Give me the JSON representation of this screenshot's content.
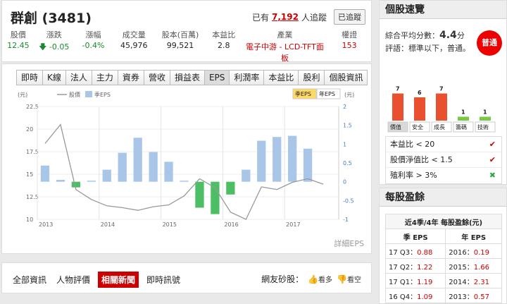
{
  "stock": {
    "name": "群創",
    "code": "(3481)"
  },
  "tracking": {
    "prefix": "已有",
    "count": "7,192",
    "suffix": "人追蹤",
    "button": "已追蹤"
  },
  "stats": [
    {
      "label": "股價",
      "value": "12.45",
      "tone": "green"
    },
    {
      "label": "漲跌",
      "value": "-0.05",
      "tone": "green",
      "arrow": "down"
    },
    {
      "label": "漲幅",
      "value": "-0.4%",
      "tone": "green"
    },
    {
      "label": "成交量",
      "value": "45,976",
      "tone": "plain"
    },
    {
      "label": "股本(百萬)",
      "value": "99,521",
      "tone": "plain"
    },
    {
      "label": "本益比",
      "value": "2.8",
      "tone": "plain"
    },
    {
      "label": "產業",
      "value": "電子中游 - LCD-TFT面板",
      "tone": "red"
    },
    {
      "label": "權證",
      "value": "153",
      "tone": "red"
    }
  ],
  "chart_tabs": [
    "即時",
    "K線",
    "法人",
    "主力",
    "資券",
    "營收",
    "損益表",
    "EPS",
    "利潤率",
    "本益比",
    "股利",
    "個股資訊"
  ],
  "active_chart_tab": "EPS",
  "detail_link": "詳細EPS",
  "chart_data": {
    "type": "bar+line",
    "legend": {
      "line": "股價",
      "bar": "季EPS"
    },
    "toggles": [
      "季EPS",
      "年EPS"
    ],
    "active_toggle": "季EPS",
    "y_left": {
      "unit": "(元)",
      "range": [
        10,
        22.5
      ],
      "ticks": [
        "22.5",
        "20",
        "17.5",
        "15",
        "12.5",
        "10"
      ]
    },
    "y_right": {
      "unit": "(元)",
      "range": [
        -1,
        2
      ],
      "ticks": [
        "2",
        "1.5",
        "1",
        "0.5",
        "0",
        "-0.5",
        "-1"
      ]
    },
    "x_ticks": [
      "2013",
      "2014",
      "2015",
      "2016",
      "2017"
    ],
    "quarters": [
      "13Q1",
      "13Q2",
      "13Q3",
      "13Q4",
      "14Q1",
      "14Q2",
      "14Q3",
      "14Q4",
      "15Q1",
      "15Q2",
      "15Q3",
      "15Q4",
      "16Q1",
      "16Q2",
      "16Q3",
      "16Q4",
      "17Q1",
      "17Q2",
      "17Q3"
    ],
    "eps": [
      0.43,
      0.05,
      -0.15,
      0.02,
      0.32,
      0.77,
      1.17,
      0.79,
      0.53,
      0.0,
      -0.69,
      -0.86,
      -0.34,
      0.32,
      1.09,
      1.19,
      1.22,
      0.88,
      null
    ],
    "price": [
      18.4,
      20.5,
      13.3,
      12.2,
      11.5,
      11.3,
      11.0,
      11.4,
      11.6,
      12.6,
      14.5,
      13.5,
      10.8,
      10.0,
      13.6,
      13.3,
      14.1,
      14.5,
      13.9
    ]
  },
  "news_tabs": [
    "全部資訊",
    "人物評價",
    "相關新聞",
    "即時訊號"
  ],
  "active_news_tab": "相關新聞",
  "vote": {
    "label": "網友砂股：",
    "up": "看多",
    "down": "看空"
  },
  "quick": {
    "title": "個股速覽",
    "score_label": "綜合平均分數：",
    "score_value": "4.4",
    "score_unit": "分",
    "review_label": "評語：標準以下，普通。",
    "badge": "普通",
    "bars": [
      {
        "label": "價值",
        "value": 7
      },
      {
        "label": "安全",
        "value": 6
      },
      {
        "label": "成長",
        "value": 7
      },
      {
        "label": "籌碼",
        "value": 1
      },
      {
        "label": "技術",
        "value": 1
      }
    ],
    "checks": [
      {
        "label": "本益比 < 20",
        "pass": true
      },
      {
        "label": "股價淨值比 < 1.5",
        "pass": true
      },
      {
        "label": "殖利率 > 3%",
        "pass": false
      }
    ]
  },
  "eps_panel": {
    "title": "每股盈餘",
    "caption": "近4季/4年 每股盈餘(元)",
    "col1": "季 EPS",
    "col2": "年 EPS",
    "rows": [
      {
        "q": "17 Q3：",
        "qv": "0.88",
        "y": "2016：",
        "yv": "0.19"
      },
      {
        "q": "17 Q2：",
        "qv": "1.22",
        "y": "2015：",
        "yv": "1.66"
      },
      {
        "q": "17 Q1：",
        "qv": "1.19",
        "y": "2014：",
        "yv": "2.31"
      },
      {
        "q": "16 Q4：",
        "qv": "1.09",
        "y": "2013：",
        "yv": "0.57"
      }
    ]
  },
  "colors": {
    "accent": "#cc0000",
    "positive_bar": "#a9c6e8",
    "negative_bar": "#4cbf64",
    "price_line": "#999999",
    "toggle_active": "#ffd966"
  }
}
